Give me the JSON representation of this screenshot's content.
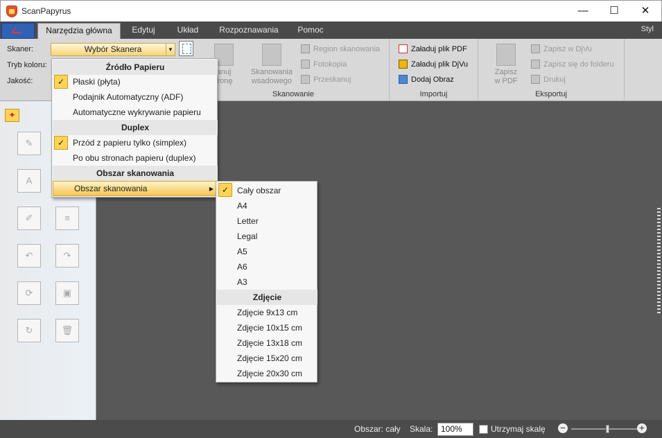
{
  "window": {
    "title": "ScanPapyrus",
    "minimize": "—",
    "maximize": "☐",
    "close": "✕"
  },
  "ribbon_tabs": {
    "items": [
      "Narzędzia główna",
      "Edytuj",
      "Układ",
      "Rozpoznawania",
      "Pomoc"
    ],
    "style": "Styl"
  },
  "scanner_controls": {
    "scanner_label": "Skaner:",
    "scanner_value": "Wybór Skanera",
    "color_mode_label": "Tryb koloru:",
    "quality_label": "Jakość:"
  },
  "scan_group": {
    "hidden_button": "Skanuj stronę",
    "hidden_button_line1": "anuj",
    "hidden_button_line2": "tronę",
    "batch_line1": "Skanowania",
    "batch_line2": "wsadowego",
    "region": "Region skanowania",
    "photo": "Fotokopia",
    "rescan": "Przeskanuj",
    "label": "Skanowanie"
  },
  "import_group": {
    "load_pdf": "Załaduj plik PDF",
    "load_djvu": "Załaduj plik DjVu",
    "add_image": "Dodaj Obraz",
    "label": "Importuj"
  },
  "export_group": {
    "save_pdf_line1": "Zapisz",
    "save_pdf_line2": "w PDF",
    "save_djvu": "Zapisz w DjVu",
    "save_folder": "Zapisz się do folderu",
    "print": "Drukuj",
    "label": "Eksportuj"
  },
  "menu_source": {
    "header_source": "Źródło Papieru",
    "flatbed": "Płaski (płyta)",
    "adf": "Podajnik Automatyczny (ADF)",
    "auto_detect": "Automatyczne wykrywanie papieru",
    "header_duplex": "Duplex",
    "simplex": "Przód z papieru tylko (simplex)",
    "duplex": "Po obu stronach papieru (duplex)",
    "header_area": "Obszar skanowania",
    "area_item": "Obszar skanowania"
  },
  "menu_area": {
    "paper_sizes": [
      "Cały obszar",
      "A4",
      "Letter",
      "Legal",
      "A5",
      "A6",
      "A3"
    ],
    "header_photo": "Zdjęcie",
    "photo_sizes": [
      "Zdjęcie 9x13 cm",
      "Zdjęcie 10x15 cm",
      "Zdjęcie 13x18 cm",
      "Zdjęcie 15x20 cm",
      "Zdjęcie 20x30 cm"
    ]
  },
  "status": {
    "area": "Obszar: cały",
    "scale_label": "Skala:",
    "scale_value": "100%",
    "keep_scale": "Utrzymaj skalę"
  },
  "icons": [
    "app-logo-icon",
    "pin-icon",
    "check-icon",
    "pdf-icon",
    "djvu-icon",
    "image-icon",
    "zoom-out-icon",
    "zoom-in-icon"
  ]
}
